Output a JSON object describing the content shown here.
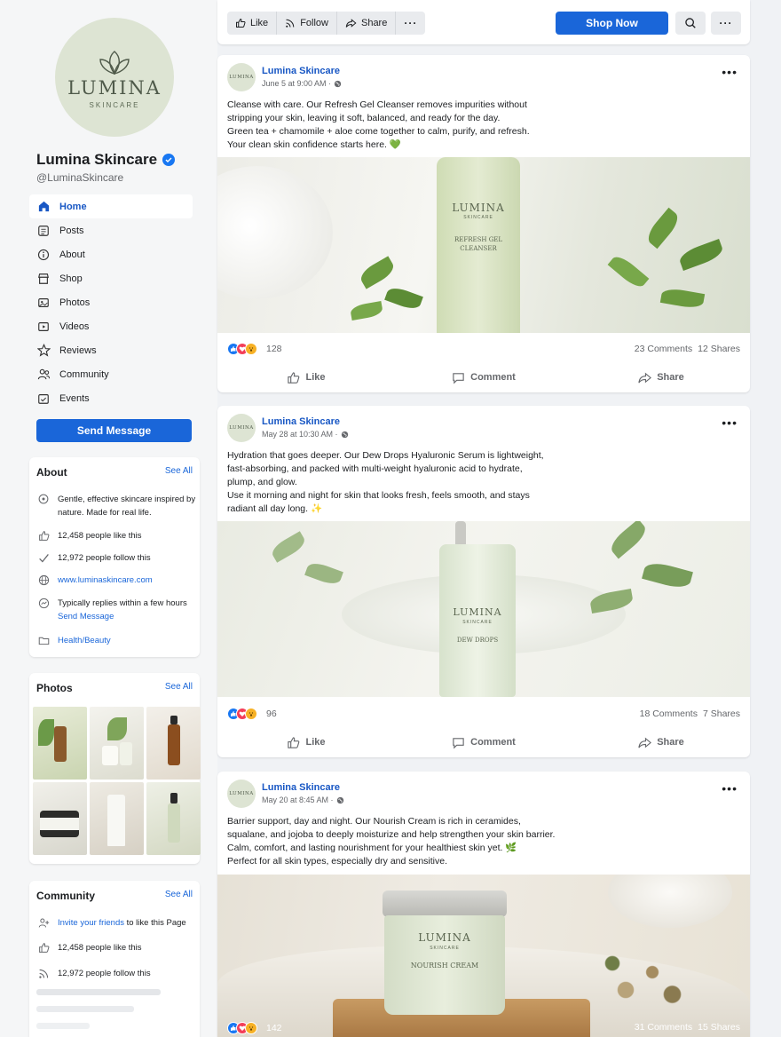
{
  "page": {
    "name": "Lumina Skincare",
    "handle": "@LuminaSkincare",
    "logo_text": "LUMINA",
    "logo_sub": "SKINCARE"
  },
  "nav": {
    "items": [
      {
        "label": "Home",
        "icon": "home-icon",
        "active": true
      },
      {
        "label": "Posts",
        "icon": "posts-icon"
      },
      {
        "label": "About",
        "icon": "info-icon"
      },
      {
        "label": "Shop",
        "icon": "shop-icon"
      },
      {
        "label": "Photos",
        "icon": "photos-icon"
      },
      {
        "label": "Videos",
        "icon": "video-icon"
      },
      {
        "label": "Reviews",
        "icon": "star-icon"
      },
      {
        "label": "Community",
        "icon": "community-icon"
      },
      {
        "label": "Events",
        "icon": "calendar-icon"
      }
    ],
    "send_message": "Send Message"
  },
  "about": {
    "title": "About",
    "see_all": "See All",
    "description": "Gentle, effective skincare inspired by nature. Made for real life.",
    "likes": "12,458 people like this",
    "follows": "12,972 people follow this",
    "website": "www.luminaskincare.com",
    "replies": "Typically replies within a few hours",
    "send_message": "Send Message",
    "category": "Health/Beauty"
  },
  "photos": {
    "title": "Photos",
    "see_all": "See All"
  },
  "community": {
    "title": "Community",
    "see_all": "See All",
    "invite_link": "Invite your friends",
    "invite_rest": " to like this Page",
    "likes": "12,458 people like this",
    "follows": "12,972 people follow this"
  },
  "topbar": {
    "like": "Like",
    "follow": "Follow",
    "share": "Share",
    "shop_now": "Shop Now"
  },
  "posts": [
    {
      "author": "Lumina Skincare",
      "time": "June 5 at 9:00 AM · ",
      "text": [
        "Cleanse with care. Our Refresh Gel Cleanser removes impurities without",
        "stripping your skin, leaving it soft, balanced, and ready for the day.",
        "Green tea + chamomile + aloe come together to calm, purify, and refresh.",
        "Your clean skin confidence starts here. 💚"
      ],
      "product_brand": "LUMINA",
      "product_sub": "SKINCARE",
      "product_name": "REFRESH GEL CLEANSER",
      "reactions": "128",
      "comments": "23 Comments",
      "shares": "12 Shares"
    },
    {
      "author": "Lumina Skincare",
      "time": "May 28 at 10:30 AM · ",
      "text": [
        "Hydration that goes deeper. Our Dew Drops Hyaluronic Serum is lightweight,",
        "fast-absorbing, and packed with multi-weight hyaluronic acid to hydrate,",
        "plump, and glow.",
        "Use it morning and night for skin that looks fresh, feels smooth, and stays",
        "radiant all day long. ✨"
      ],
      "product_brand": "LUMINA",
      "product_sub": "SKINCARE",
      "product_name": "DEW DROPS",
      "reactions": "96",
      "comments": "18 Comments",
      "shares": "7 Shares"
    },
    {
      "author": "Lumina Skincare",
      "time": "May 20 at 8:45 AM · ",
      "text": [
        "Barrier support, day and night. Our Nourish Cream is rich in ceramides,",
        "squalane, and jojoba to deeply moisturize and help strengthen your skin barrier.",
        "Calm, comfort, and lasting nourishment for your healthiest skin yet. 🌿",
        "Perfect for all skin types, especially dry and sensitive."
      ],
      "product_brand": "LUMINA",
      "product_sub": "SKINCARE",
      "product_name": "NOURISH CREAM",
      "reactions": "142",
      "comments": "31 Comments",
      "shares": "15 Shares"
    }
  ],
  "actions": {
    "like": "Like",
    "comment": "Comment",
    "share": "Share"
  },
  "colors": {
    "accent": "#1a66d9",
    "brand_sage": "#dde4d3",
    "link": "#1857c4"
  }
}
